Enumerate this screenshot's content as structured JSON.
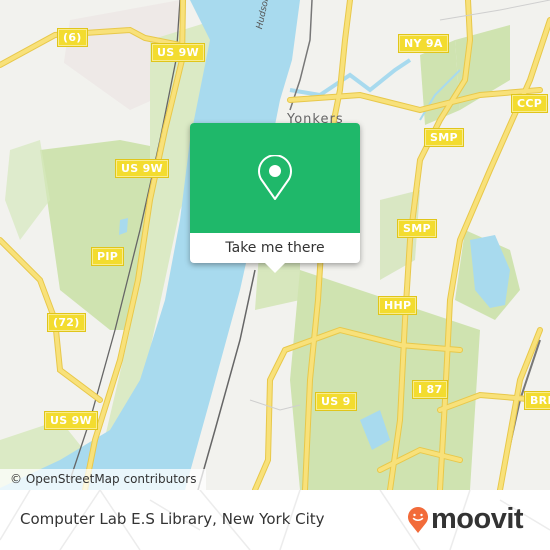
{
  "map": {
    "attribution": "© OpenStreetMap contributors",
    "place_labels": {
      "yonkers": "Yonkers"
    },
    "water_labels": {
      "hudson": "Hudson"
    },
    "road_shields": {
      "r6": "(6)",
      "us9w_top": "US 9W",
      "us9w_mid": "US 9W",
      "us9w_bottom": "US 9W",
      "pip": "PIP",
      "r72": "(72)",
      "ny9a": "NY 9A",
      "ccp": "CCP",
      "smp_top": "SMP",
      "smp_mid": "SMP",
      "hhp": "HHP",
      "us9": "US 9",
      "i87": "I 87",
      "brp": "BRP"
    },
    "colors": {
      "land": "#f2f2ee",
      "water": "#a8daee",
      "park": "#cfe3b0",
      "road": "#f6dd5a",
      "shield": "#f3dc2f"
    }
  },
  "popup": {
    "icon": "map-pin-icon",
    "button_label": "Take me there",
    "color": "#1fb86a"
  },
  "footer": {
    "location_title": "Computer Lab E.S Library, New York City",
    "brand": "moovit",
    "brand_color": "#f26b3a"
  }
}
